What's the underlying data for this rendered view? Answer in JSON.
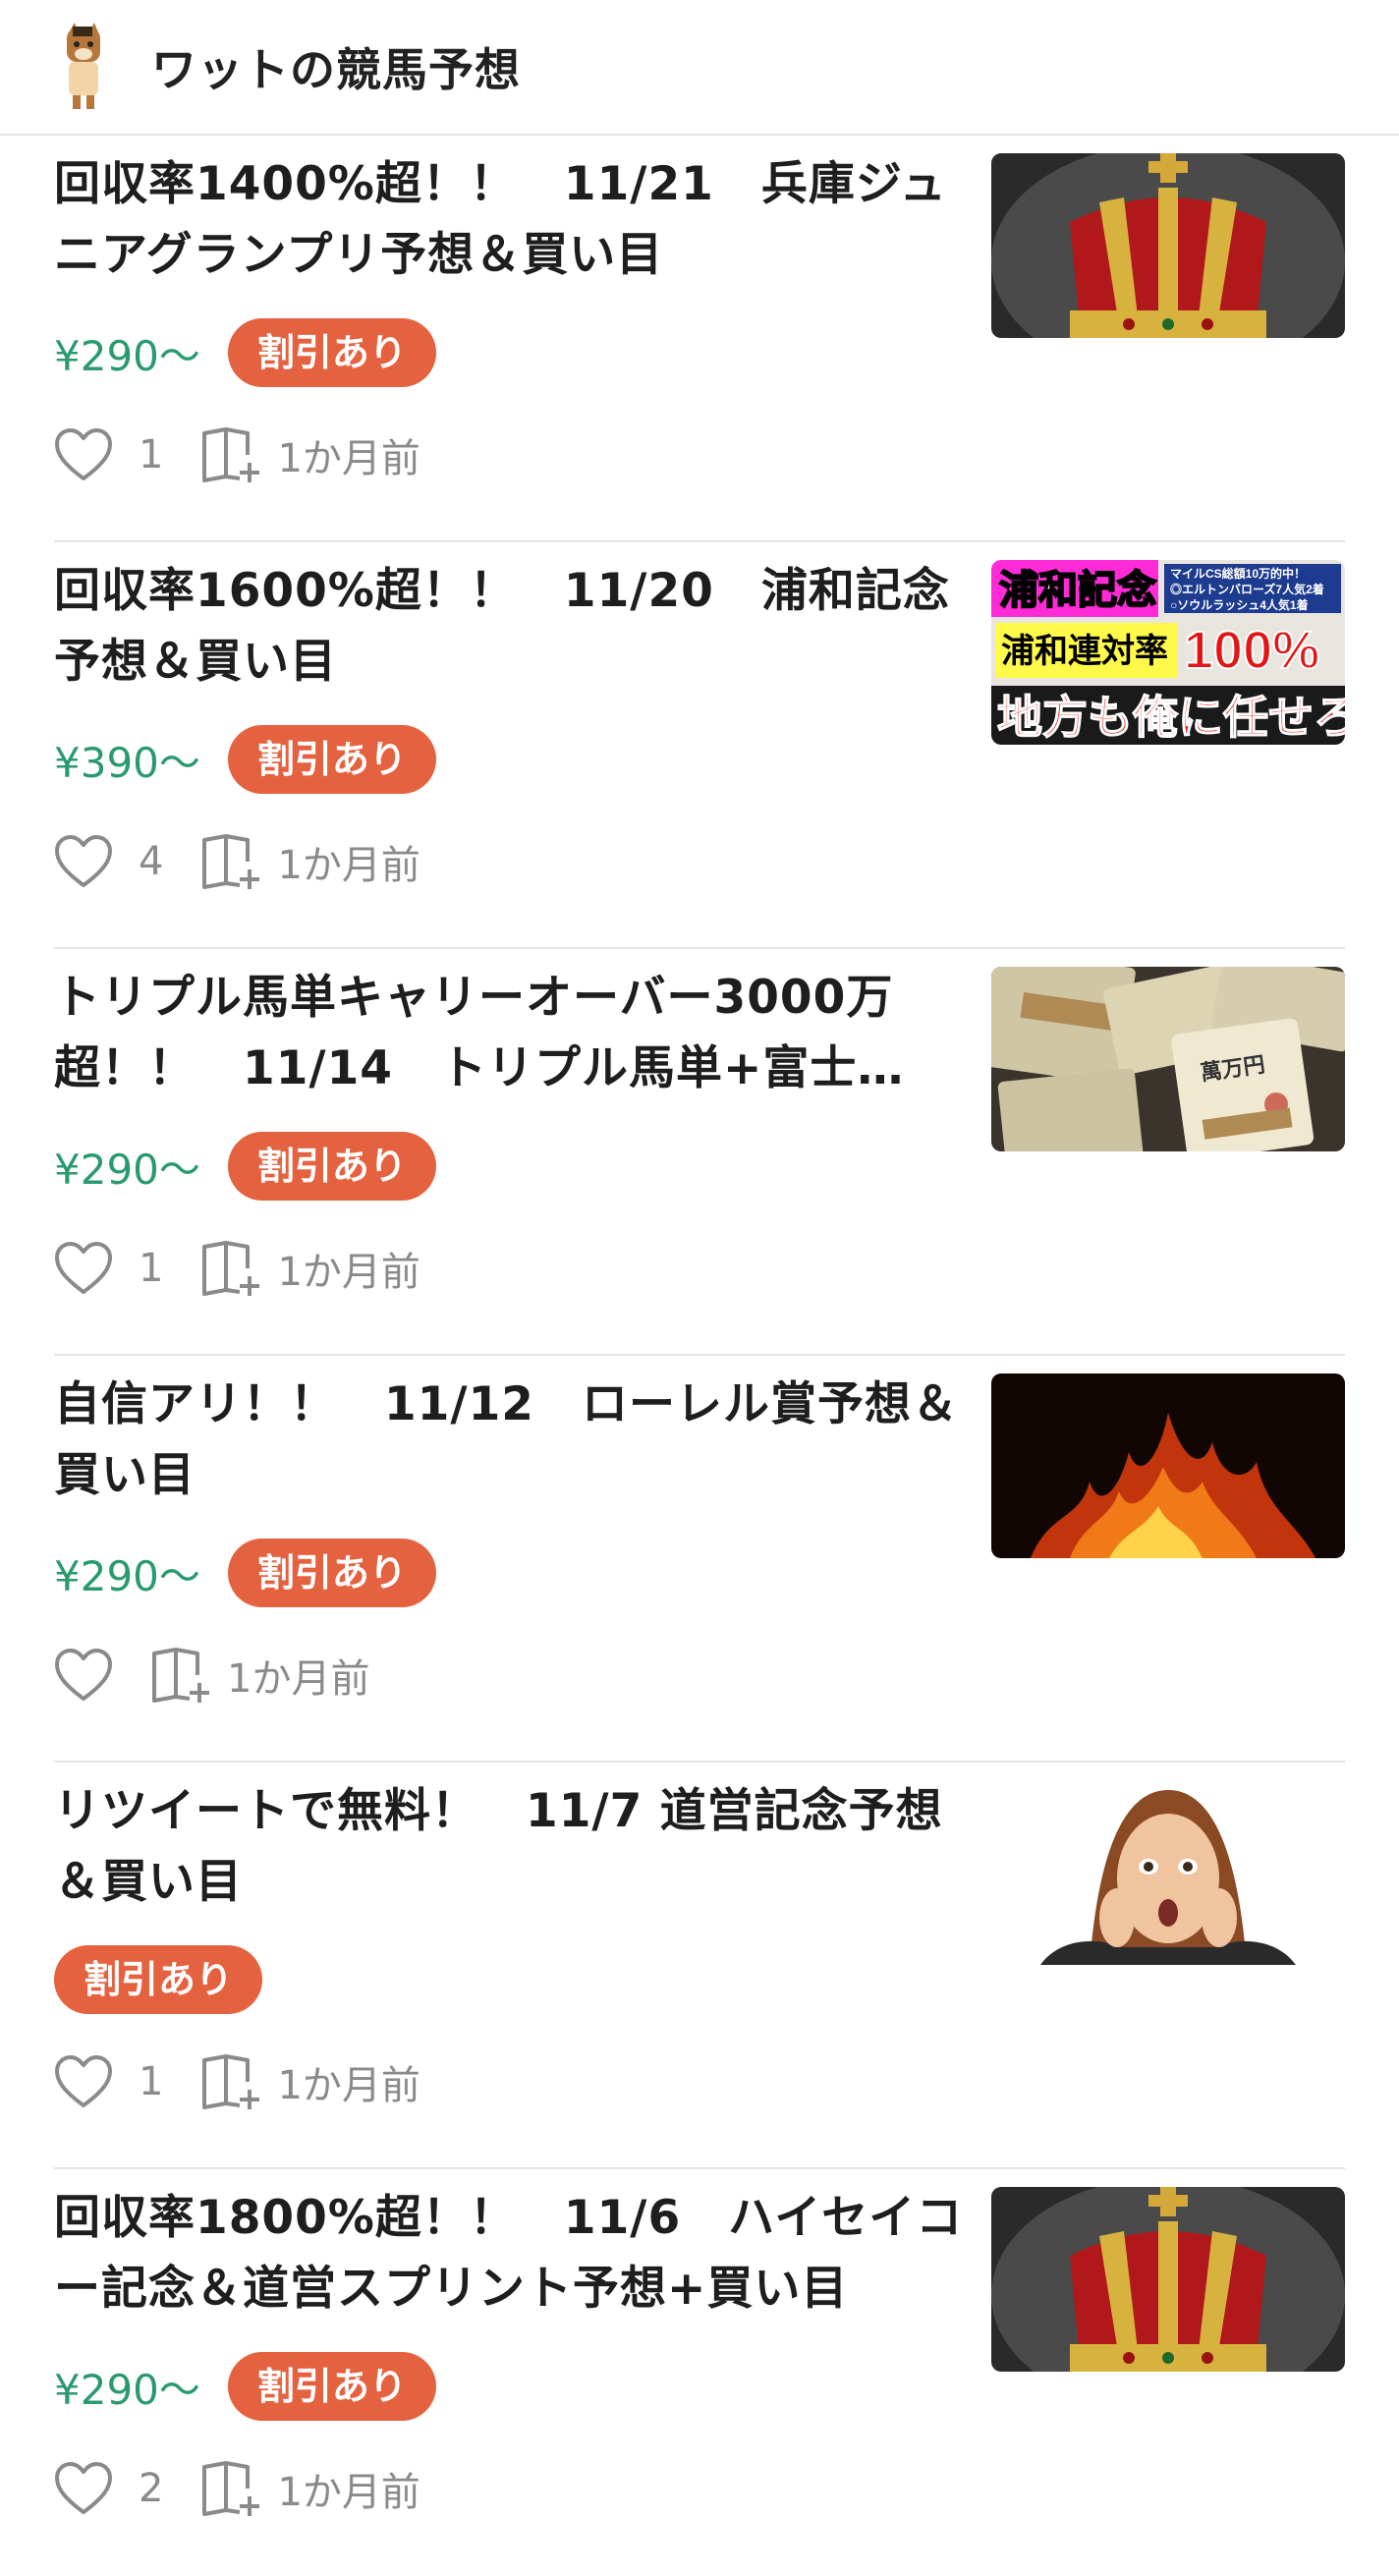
{
  "header": {
    "title": "ワットの競馬予想",
    "logo_icon": "horse-avatar-icon"
  },
  "colors": {
    "price": "#2a9a6e",
    "badge": "#e4623f",
    "divider": "#e4e4e4"
  },
  "items": [
    {
      "title": "回収率1400%超！！　11/21　兵庫ジュニアグランプリ予想＆買い目",
      "price": "¥290〜",
      "badge": "割引あり",
      "likes": "1",
      "time": "1か月前",
      "thumb": "crown-image"
    },
    {
      "title": "回収率1600%超！！　11/20　浦和記念予想＆買い目",
      "price": "¥390〜",
      "badge": "割引あり",
      "likes": "4",
      "time": "1か月前",
      "thumb": "urawa-promo-image",
      "thumb_text": {
        "title": "浦和記念",
        "sub1": "マイルCS総額10万的中！",
        "sub2": "◎エルトンバローズ7人気2着",
        "sub3": "○ソウルラッシュ4人気1着",
        "rate_label": "浦和連対率",
        "rate_value": "100%",
        "slogan": "地方も俺に任せろ！"
      }
    },
    {
      "title": "トリプル馬単キャリーオーバー3000万超！！　11/14　トリプル馬単+富士…",
      "price": "¥290〜",
      "badge": "割引あり",
      "likes": "1",
      "time": "1か月前",
      "thumb": "money-bundles-image",
      "thumb_text": {
        "note_label": "萬万円"
      }
    },
    {
      "title": "自信アリ！！　11/12　ローレル賞予想＆買い目",
      "price": "¥290〜",
      "badge": "割引あり",
      "likes": "",
      "time": "1か月前",
      "thumb": "fire-image"
    },
    {
      "title": "リツイートで無料！　11/7 道営記念予想＆買い目",
      "price": "",
      "badge": "割引あり",
      "likes": "1",
      "time": "1か月前",
      "thumb": "surprised-woman-image"
    },
    {
      "title": "回収率1800%超！！　11/6　ハイセイコー記念＆道営スプリント予想+買い目",
      "price": "¥290〜",
      "badge": "割引あり",
      "likes": "2",
      "time": "1か月前",
      "thumb": "crown-image"
    }
  ]
}
